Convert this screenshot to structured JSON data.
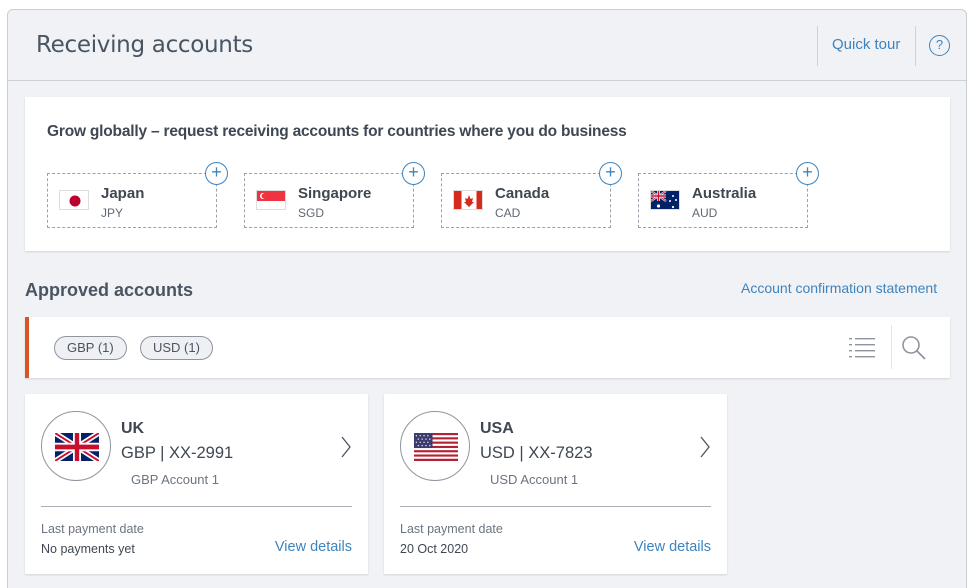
{
  "header": {
    "title": "Receiving accounts",
    "quick_tour": "Quick tour",
    "help": "?"
  },
  "grow": {
    "title": "Grow globally – request receiving accounts for countries where you do business",
    "countries": [
      {
        "name": "Japan",
        "code": "JPY",
        "flag_icon": "japan-flag-icon"
      },
      {
        "name": "Singapore",
        "code": "SGD",
        "flag_icon": "singapore-flag-icon"
      },
      {
        "name": "Canada",
        "code": "CAD",
        "flag_icon": "canada-flag-icon"
      },
      {
        "name": "Australia",
        "code": "AUD",
        "flag_icon": "australia-flag-icon"
      }
    ]
  },
  "approved": {
    "title": "Approved accounts",
    "confirmation_link": "Account confirmation statement",
    "filters": [
      "GBP (1)",
      "USD (1)"
    ]
  },
  "accounts": [
    {
      "country": "UK",
      "number": "GBP | XX-2991",
      "name": "GBP Account 1",
      "last_payment_label": "Last payment date",
      "last_payment_value": "No payments yet",
      "view_details": "View details",
      "flag_icon": "uk-flag-icon"
    },
    {
      "country": "USA",
      "number": "USD | XX-7823",
      "name": "USD Account 1",
      "last_payment_label": "Last payment date",
      "last_payment_value": "20 Oct 2020",
      "view_details": "View details",
      "flag_icon": "us-flag-icon"
    }
  ],
  "colors": {
    "accent": "#3d83bd",
    "bar_accent": "#d9541e",
    "text": "#3f4752",
    "background": "#f0f2f5"
  }
}
